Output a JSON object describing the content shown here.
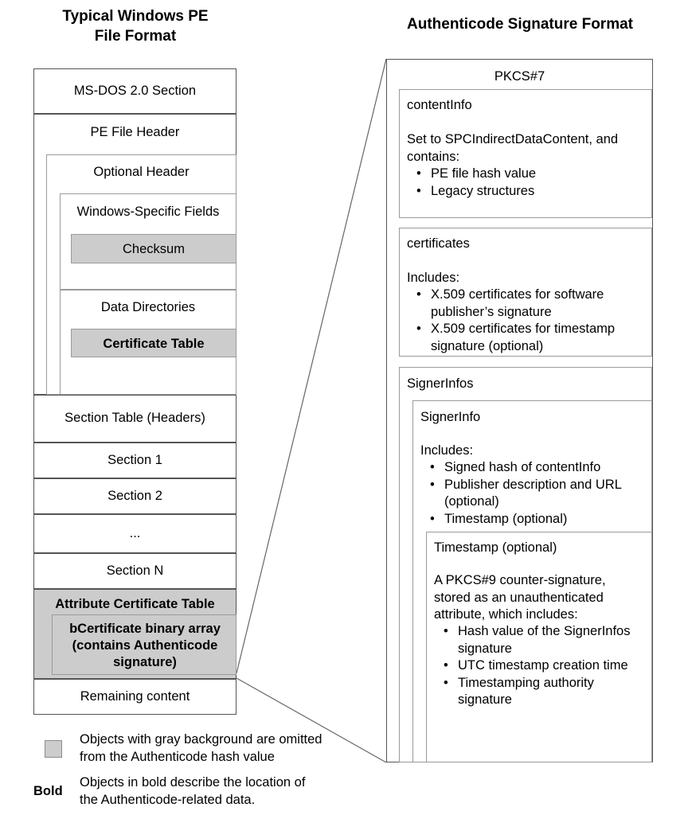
{
  "titles": {
    "left_line1": "Typical Windows PE",
    "left_line2": "File Format",
    "right": "Authenticode Signature Format"
  },
  "pe_file": {
    "rows": {
      "msdos": "MS-DOS 2.0 Section",
      "pe_file_header": "PE File Header",
      "optional_header": "Optional Header",
      "windows_specific_fields": "Windows-Specific Fields",
      "checksum": "Checksum",
      "data_directories": "Data Directories",
      "certificate_table": "Certificate Table",
      "section_table": "Section Table (Headers)",
      "section_1": "Section 1",
      "section_2": "Section 2",
      "section_ellipsis": "...",
      "section_n": "Section N",
      "attribute_certificate_table": "Attribute Certificate Table",
      "bcertificate": "bCertificate binary array (contains Authenticode signature)",
      "remaining_content": "Remaining content"
    }
  },
  "authenticode": {
    "pkcs7_title": "PKCS#7",
    "content_info": {
      "title": "contentInfo",
      "body": "Set to SPCIndirectDataContent, and contains:",
      "bullets": [
        "PE file hash value",
        "Legacy structures"
      ]
    },
    "certificates": {
      "title": "certificates",
      "body": "Includes:",
      "bullets": [
        "X.509 certificates for software publisher’s signature",
        "X.509 certificates for timestamp signature (optional)"
      ]
    },
    "signer_infos": {
      "title": "SignerInfos"
    },
    "signer_info": {
      "title": "SignerInfo",
      "body": "Includes:",
      "bullets": [
        "Signed hash of contentInfo",
        "Publisher description and URL (optional)",
        "Timestamp (optional)"
      ]
    },
    "timestamp": {
      "title": "Timestamp (optional)",
      "body": "A PKCS#9 counter-signature, stored as an unauthenticated attribute, which includes:",
      "bullets": [
        "Hash value of the SignerInfos signature",
        "UTC timestamp creation time",
        "Timestamping authority signature"
      ]
    }
  },
  "legend": {
    "gray_line1": "Objects with gray background are omitted",
    "gray_line2": "from the Authenticode hash value",
    "bold_marker": "Bold",
    "bold_line1": "Objects in bold describe the location of",
    "bold_line2": "the Authenticode-related data."
  },
  "colors": {
    "gray_fill": "#cccccc",
    "border": "#9a9a9a",
    "border_dark": "#555555",
    "text": "#000000",
    "background": "#ffffff"
  }
}
